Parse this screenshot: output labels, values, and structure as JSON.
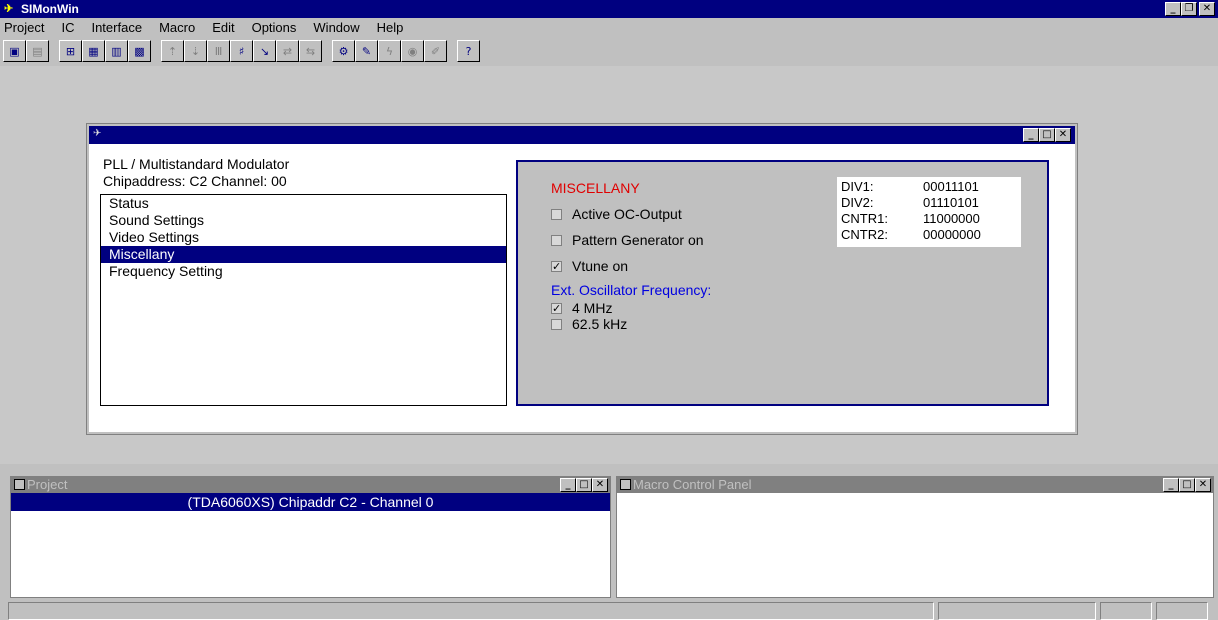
{
  "app": {
    "title": "SIMonWin"
  },
  "menu": [
    "Project",
    "IC",
    "Interface",
    "Macro",
    "Edit",
    "Options",
    "Window",
    "Help"
  ],
  "toolbar_icons": [
    "new-project-icon",
    "close-project-icon",
    "add-ic-icon",
    "ic-register-icon",
    "ic-view-icon",
    "ic-settings-icon",
    "upload-icon",
    "download-icon",
    "bus-read-icon",
    "bus-write-icon",
    "pointer-icon",
    "macro-record-icon",
    "macro-edit-icon",
    "run-icon",
    "edit-ic-icon",
    "lightning-icon",
    "stop-icon",
    "pen-icon",
    "help-icon"
  ],
  "child": {
    "device_name": "PLL / Multistandard Modulator",
    "chip_line": "Chipaddress: C2  Channel: 00",
    "nav_items": [
      "Status",
      "Sound Settings",
      "Video Settings",
      "Miscellany",
      "Frequency Setting"
    ],
    "selected_index": 3,
    "misc": {
      "title": "MISCELLANY",
      "active_oc_output": {
        "label": "Active OC-Output",
        "checked": false
      },
      "pattern_generator": {
        "label": "Pattern Generator on",
        "checked": false
      },
      "vtune": {
        "label": "Vtune on",
        "checked": true
      },
      "ext_osc_label": "Ext. Oscillator Frequency:",
      "osc_4mhz": {
        "label": "4 MHz",
        "checked": true
      },
      "osc_625khz": {
        "label": "62.5 kHz",
        "checked": false
      }
    },
    "registers": [
      {
        "name": "DIV1:",
        "value": "00011101"
      },
      {
        "name": "DIV2:",
        "value": "01110101"
      },
      {
        "name": "CNTR1:",
        "value": "11000000"
      },
      {
        "name": "CNTR2:",
        "value": "00000000"
      }
    ]
  },
  "project_pane": {
    "title": "Project",
    "row": "(TDA6060XS)  Chipaddr C2 - Channel 0"
  },
  "macro_pane": {
    "title": "Macro Control Panel"
  },
  "colors": {
    "titlebar": "#000080",
    "misc_title": "#e00000",
    "ext_label": "#0000e0"
  }
}
